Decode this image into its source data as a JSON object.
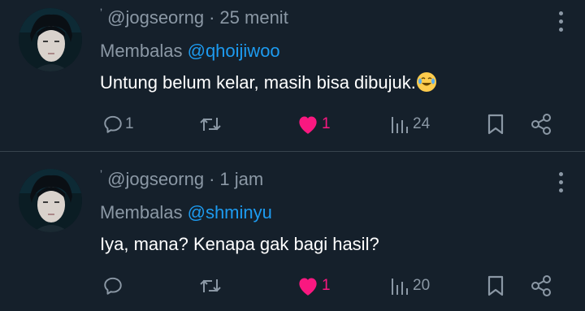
{
  "colors": {
    "background": "#15202b",
    "text": "#ffffff",
    "muted": "#8b98a5",
    "link": "#1d9bf0",
    "like": "#f91880",
    "separator": "#38444d"
  },
  "tweets": [
    {
      "handle": "@jogseorng",
      "time_sep": "·",
      "time": "25 menit",
      "reply_prefix": "Membalas",
      "reply_to": "@qhoijiwoo",
      "text": "Untung belum kelar, masih bisa dibujuk.",
      "emoji": "face-with-tears-of-joy",
      "replies": "1",
      "retweets": "",
      "likes": "1",
      "views": "24",
      "liked": true
    },
    {
      "handle": "@jogseorng",
      "time_sep": "·",
      "time": "1 jam",
      "reply_prefix": "Membalas",
      "reply_to": "@shminyu",
      "text": "Iya, mana? Kenapa gak bagi hasil?",
      "replies": "",
      "retweets": "",
      "likes": "1",
      "views": "20",
      "liked": true
    }
  ]
}
